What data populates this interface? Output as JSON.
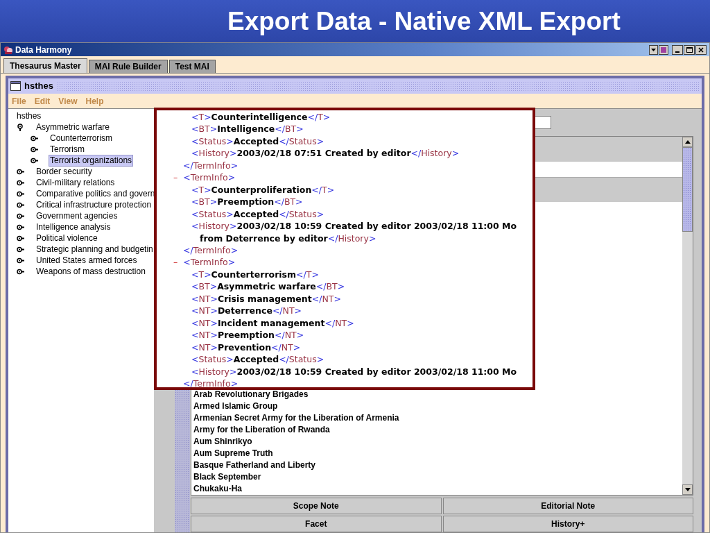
{
  "slide": {
    "title": "Export Data - Native XML Export"
  },
  "window": {
    "title": "Data Harmony"
  },
  "tabs": [
    {
      "label": "Thesaurus Master",
      "selected": true
    },
    {
      "label": "MAI Rule Builder",
      "selected": false
    },
    {
      "label": "Test MAI",
      "selected": false
    }
  ],
  "inner_window": {
    "title": "hsthes"
  },
  "menu": [
    "File",
    "Edit",
    "View",
    "Help"
  ],
  "tree": {
    "root": "hsthes",
    "nodes": [
      {
        "label": "Asymmetric warfare",
        "expanded": true,
        "selected": false,
        "children": [
          {
            "label": "Counterterrorism",
            "expanded": false,
            "selected": false
          },
          {
            "label": "Terrorism",
            "expanded": false,
            "selected": false
          },
          {
            "label": "Terrorist organizations",
            "expanded": false,
            "selected": true
          }
        ]
      },
      {
        "label": "Border security",
        "expanded": false,
        "selected": false
      },
      {
        "label": "Civil-military relations",
        "expanded": false,
        "selected": false
      },
      {
        "label": "Comparative politics and govern",
        "expanded": false,
        "selected": false
      },
      {
        "label": "Critical infrastructure protection",
        "expanded": false,
        "selected": false
      },
      {
        "label": "Government agencies",
        "expanded": false,
        "selected": false
      },
      {
        "label": "Intelligence analysis",
        "expanded": false,
        "selected": false
      },
      {
        "label": "Political violence",
        "expanded": false,
        "selected": false
      },
      {
        "label": "Strategic planning and budgetin",
        "expanded": false,
        "selected": false
      },
      {
        "label": "United States armed forces",
        "expanded": false,
        "selected": false
      },
      {
        "label": "Weapons of mass destruction",
        "expanded": false,
        "selected": false
      }
    ]
  },
  "xml_view": {
    "blocks": [
      {
        "children": [
          {
            "open": "<T>",
            "text": "Counterintelligence",
            "close": "</T>"
          },
          {
            "open": "<BT>",
            "text": "Intelligence",
            "close": "</BT>"
          },
          {
            "open": "<Status>",
            "text": "Accepted",
            "close": "</Status>"
          },
          {
            "open": "<History>",
            "text": "2003/02/18 07:51 Created by editor",
            "close": "</History>"
          }
        ],
        "close": "</TermInfo>"
      },
      {
        "toggle": "–",
        "open": "<TermInfo>",
        "children": [
          {
            "open": "<T>",
            "text": "Counterproliferation",
            "close": "</T>"
          },
          {
            "open": "<BT>",
            "text": "Preemption",
            "close": "</BT>"
          },
          {
            "open": "<Status>",
            "text": "Accepted",
            "close": "</Status>"
          },
          {
            "open": "<History>",
            "text": "2003/02/18 10:59 Created by editor 2003/02/18 11:00 Mo",
            "continuation": "from Deterrence by editor",
            "close": "</History>"
          }
        ],
        "close": "</TermInfo>"
      },
      {
        "toggle": "–",
        "open": "<TermInfo>",
        "children": [
          {
            "open": "<T>",
            "text": "Counterterrorism",
            "close": "</T>"
          },
          {
            "open": "<BT>",
            "text": "Asymmetric warfare",
            "close": "</BT>"
          },
          {
            "open": "<NT>",
            "text": "Crisis management",
            "close": "</NT>"
          },
          {
            "open": "<NT>",
            "text": "Deterrence",
            "close": "</NT>"
          },
          {
            "open": "<NT>",
            "text": "Incident management",
            "close": "</NT>"
          },
          {
            "open": "<NT>",
            "text": "Preemption",
            "close": "</NT>"
          },
          {
            "open": "<NT>",
            "text": "Prevention",
            "close": "</NT>"
          },
          {
            "open": "<Status>",
            "text": "Accepted",
            "close": "</Status>"
          },
          {
            "open": "<History>",
            "text": "2003/02/18 10:59 Created by editor 2003/02/18 11:00 Mo"
          }
        ],
        "close": "</TermInfo>"
      }
    ]
  },
  "term_list": {
    "items": [
      "Arab Revolutionary Brigades",
      "Armed Islamic Group",
      "Armenian Secret Army for the Liberation of Armenia",
      "Army for the Liberation of Rwanda",
      "Aum Shinrikyo",
      "Aum Supreme Truth",
      "Basque Fatherland and Liberty",
      "Black September",
      "Chukaku-Ha"
    ]
  },
  "buttons": [
    "Scope Note",
    "Editorial Note",
    "Facet",
    "History+"
  ]
}
